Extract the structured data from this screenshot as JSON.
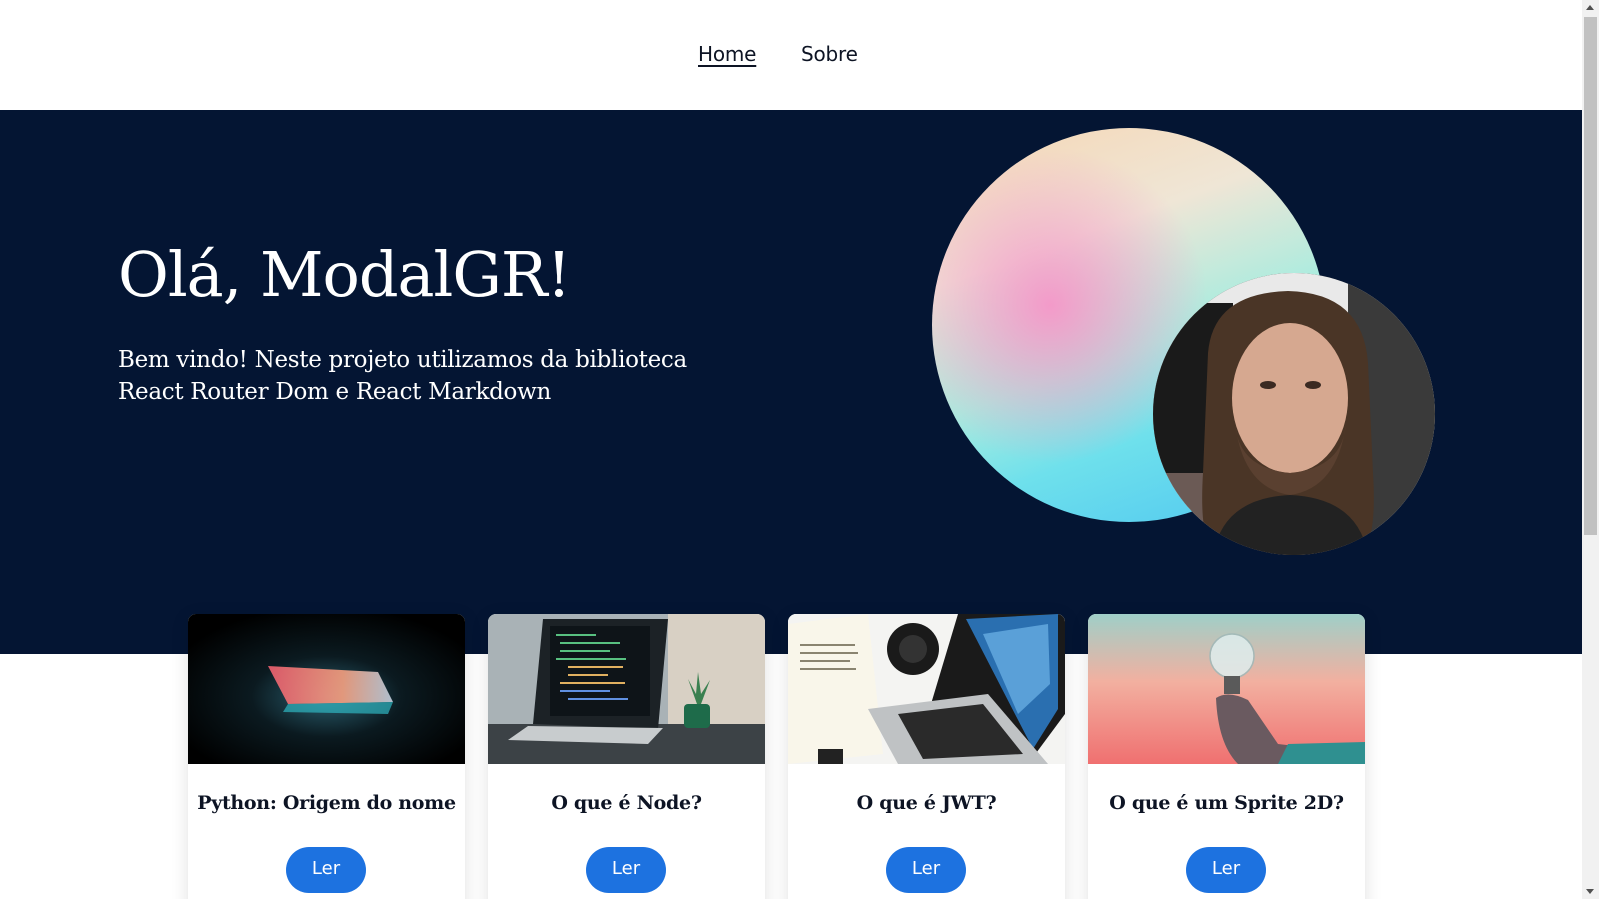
{
  "nav": {
    "links": [
      {
        "label": "Home",
        "active": true
      },
      {
        "label": "Sobre",
        "active": false
      }
    ]
  },
  "hero": {
    "title": "Olá, ModalGR!",
    "subtitle": "Bem vindo! Neste projeto utilizamos da biblioteca React Router Dom e React Markdown",
    "background_color": "#041533"
  },
  "cards": [
    {
      "title": "Python: Origem do nome",
      "button_label": "Ler",
      "image": "laptop-dark-glow"
    },
    {
      "title": "O que é Node?",
      "button_label": "Ler",
      "image": "laptop-code-desk"
    },
    {
      "title": "O que é JWT?",
      "button_label": "Ler",
      "image": "laptop-desk-topview"
    },
    {
      "title": "O que é um Sprite 2D?",
      "button_label": "Ler",
      "image": "hand-lightbulb"
    }
  ],
  "colors": {
    "accent": "#1d72e0",
    "text_dark": "#0d1424"
  }
}
